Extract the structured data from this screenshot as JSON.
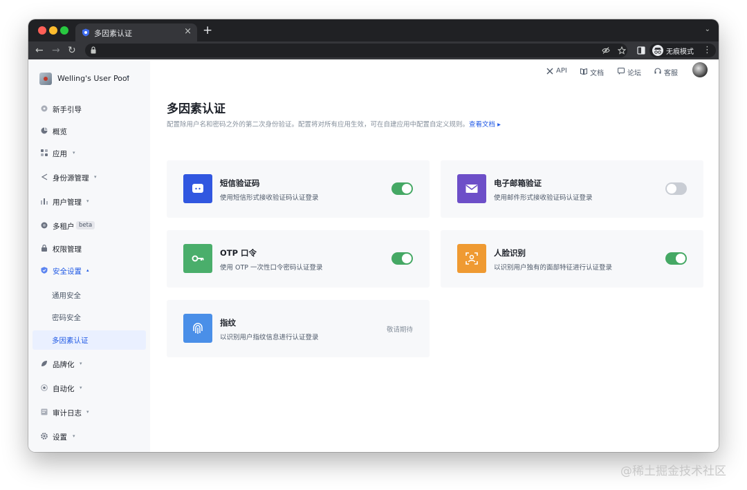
{
  "browser": {
    "tab_title": "多因素认证",
    "tab_close": "×",
    "new_tab": "+",
    "tabs_menu": "⌄",
    "incognito_label": "无痕模式",
    "nav_back": "←",
    "nav_forward": "→",
    "nav_reload": "↻",
    "more": "⋮"
  },
  "sidebar": {
    "pool_name": "Welling's User Pool",
    "items": [
      {
        "label": "新手引导",
        "icon": "guide-icon"
      },
      {
        "label": "概览",
        "icon": "pie-icon"
      },
      {
        "label": "应用",
        "icon": "apps-icon",
        "caret": "▾"
      },
      {
        "label": "身份源管理",
        "icon": "share-icon",
        "caret": "▾"
      },
      {
        "label": "用户管理",
        "icon": "users-icon",
        "caret": "▾"
      },
      {
        "label": "多租户",
        "icon": "tenant-icon",
        "badge": "beta"
      },
      {
        "label": "权限管理",
        "icon": "lock-icon"
      },
      {
        "label": "安全设置",
        "icon": "shield-icon",
        "caret": "▴",
        "active": true
      },
      {
        "label": "品牌化",
        "icon": "brand-icon",
        "caret": "▾"
      },
      {
        "label": "自动化",
        "icon": "auto-icon",
        "caret": "▾"
      },
      {
        "label": "审计日志",
        "icon": "log-icon",
        "caret": "▾"
      },
      {
        "label": "设置",
        "icon": "gear-icon",
        "caret": "▾"
      }
    ],
    "sub_items": [
      {
        "label": "通用安全"
      },
      {
        "label": "密码安全"
      },
      {
        "label": "多因素认证",
        "active": true
      }
    ]
  },
  "topnav": {
    "api": "API",
    "docs": "文档",
    "forum": "论坛",
    "support": "客服"
  },
  "page": {
    "title": "多因素认证",
    "description": "配置除用户名和密码之外的第二次身份验证。配置将对所有应用生效，可在自建应用中配置自定义规则。",
    "doc_link": "查看文档"
  },
  "colors": {
    "sms": "#3157e0",
    "email": "#6d4fc8",
    "otp": "#4aae6b",
    "face": "#ef9a32",
    "fingerprint": "#4a8fe8",
    "switch_on": "#45a864",
    "switch_off": "#c9cdd4",
    "accent": "#215ae5"
  },
  "factors": [
    {
      "title": "短信验证码",
      "desc": "使用短信形式接收验证码认证登录",
      "enabled": true
    },
    {
      "title": "电子邮箱验证",
      "desc": "使用邮件形式接收验证码认证登录",
      "enabled": false
    },
    {
      "title": "OTP 口令",
      "desc": "使用 OTP 一次性口令密码认证登录",
      "enabled": true
    },
    {
      "title": "人脸识别",
      "desc": "以识别用户独有的面部特征进行认证登录",
      "enabled": true
    },
    {
      "title": "指纹",
      "desc": "以识别用户指纹信息进行认证登录",
      "status": "敬请期待"
    }
  ],
  "watermark": "@稀土掘金技术社区"
}
